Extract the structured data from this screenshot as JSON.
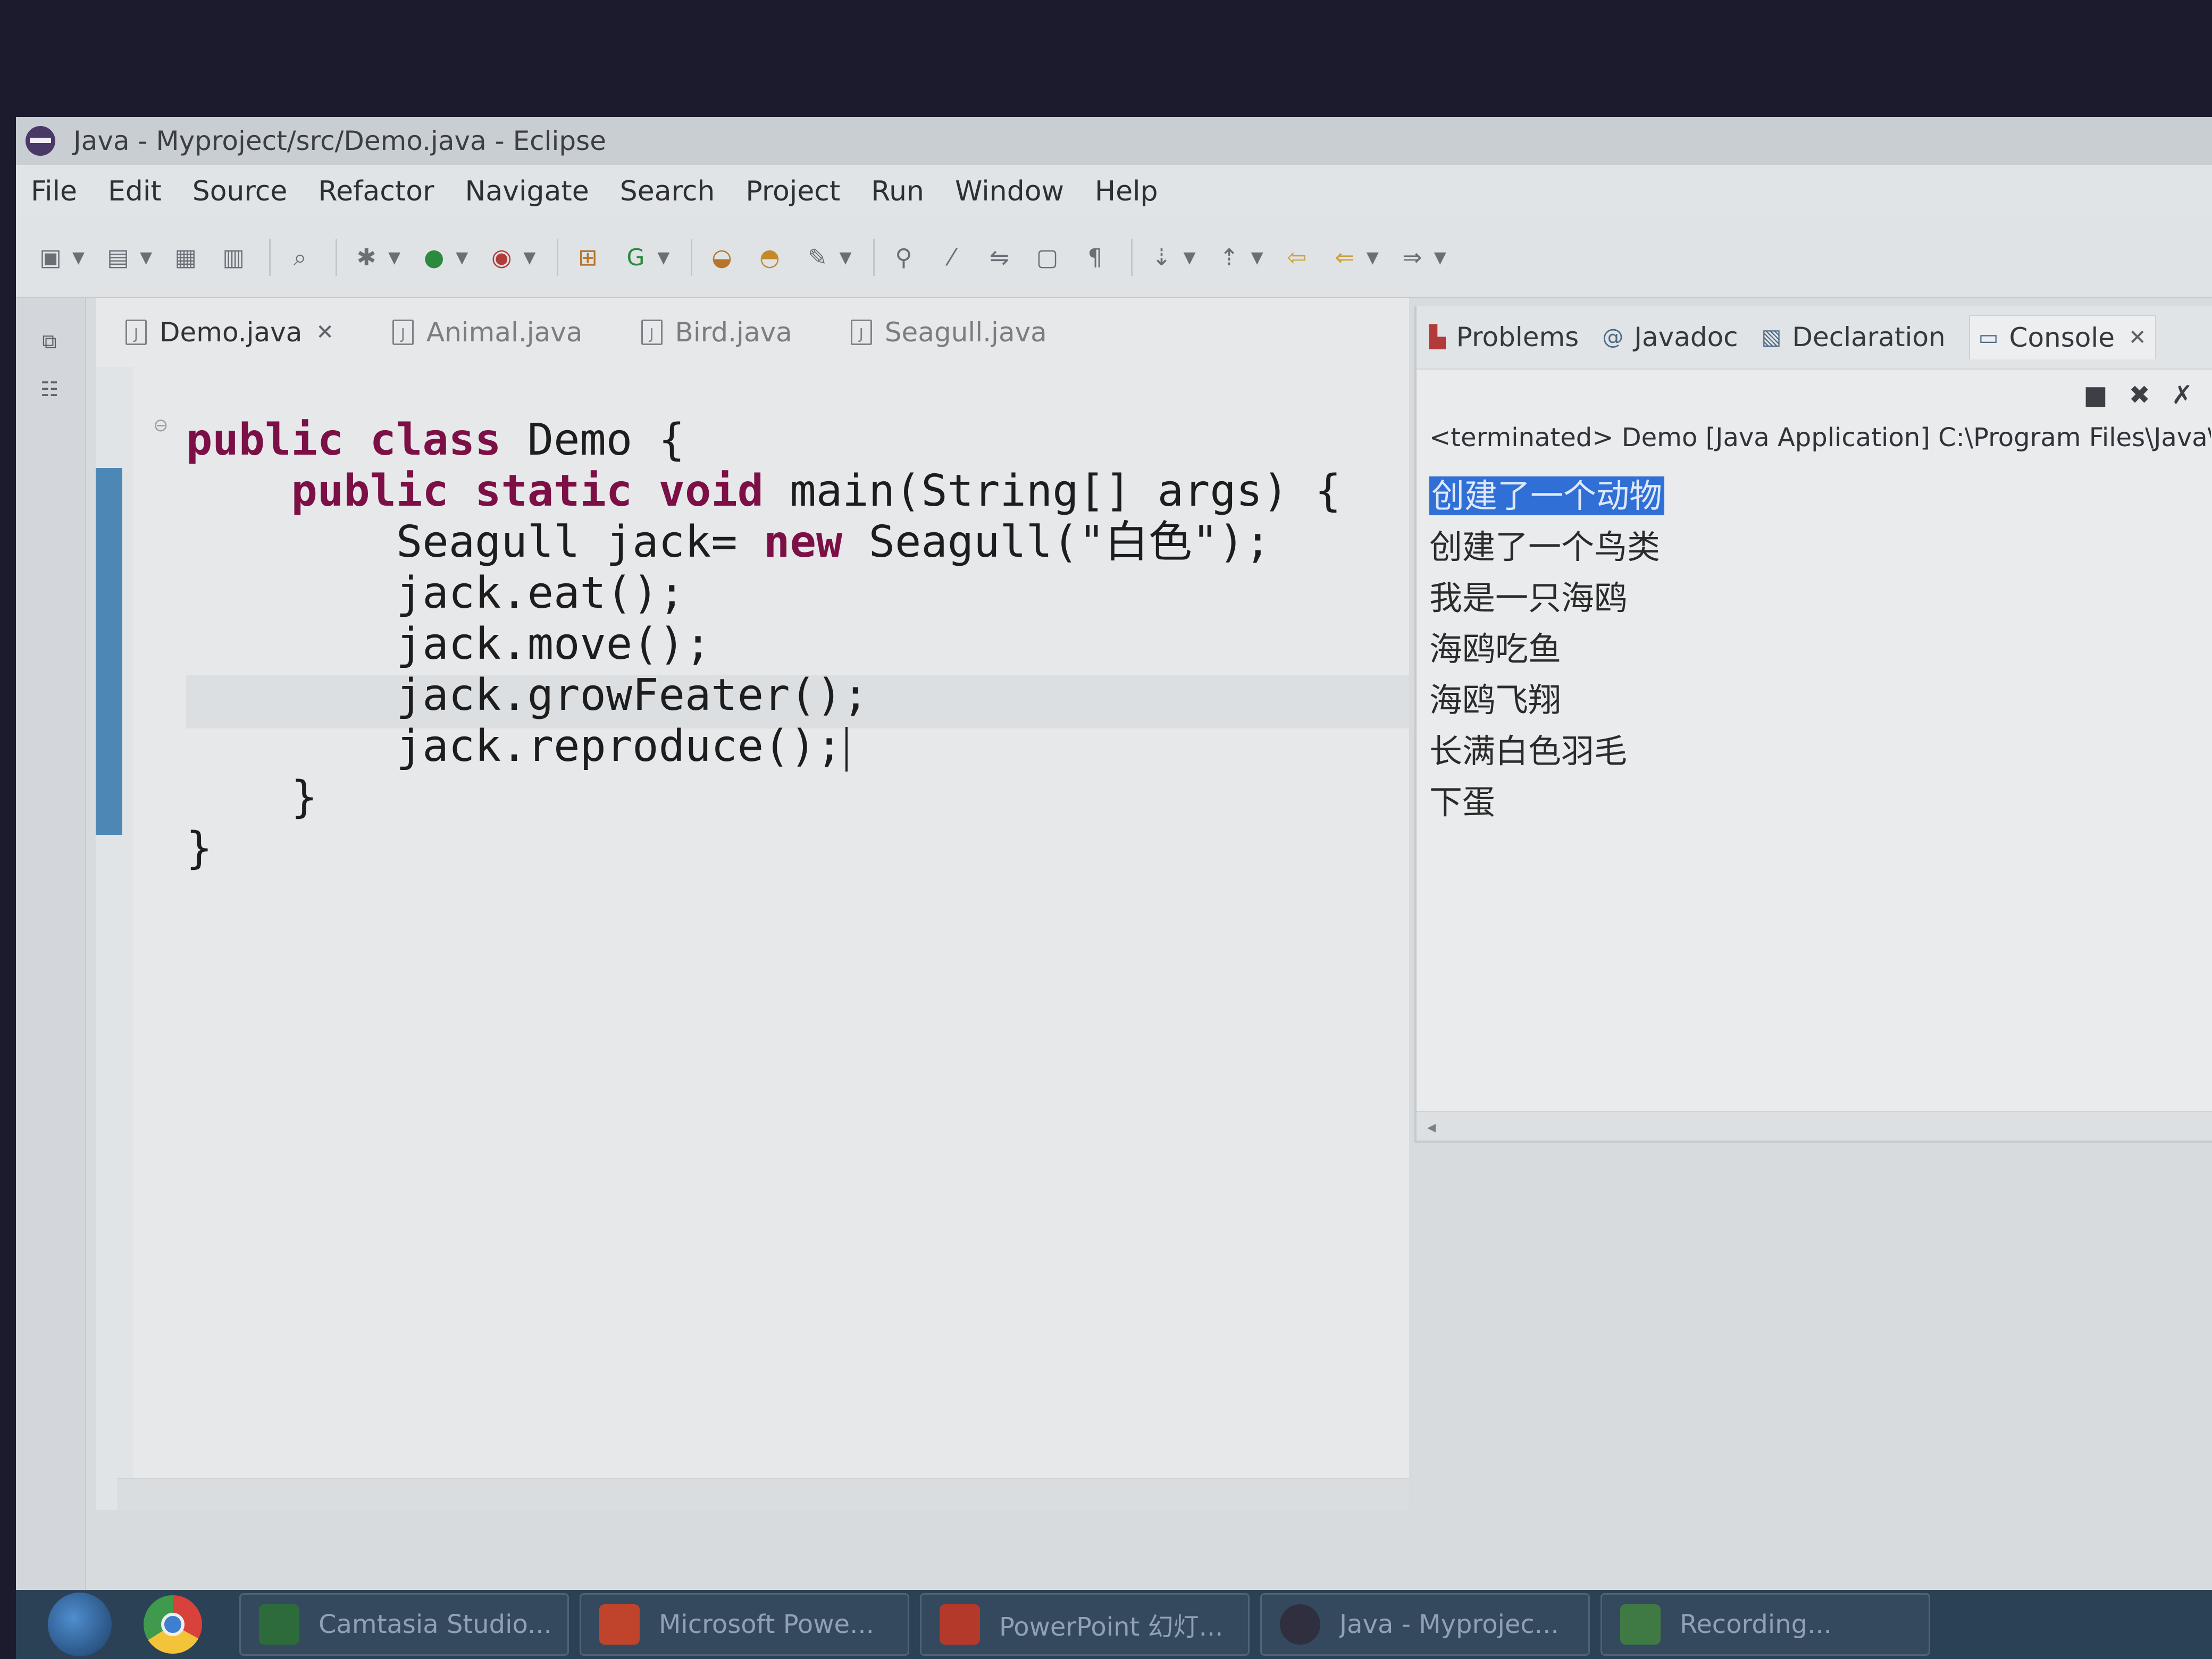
{
  "window": {
    "title": "Java - Myproject/src/Demo.java - Eclipse"
  },
  "menu": [
    "File",
    "Edit",
    "Source",
    "Refactor",
    "Navigate",
    "Search",
    "Project",
    "Run",
    "Window",
    "Help"
  ],
  "editor": {
    "tabs": [
      {
        "label": "Demo.java",
        "active": true
      },
      {
        "label": "Animal.java",
        "active": false
      },
      {
        "label": "Bird.java",
        "active": false
      },
      {
        "label": "Seagull.java",
        "active": false
      }
    ],
    "code": {
      "l1": {
        "kw1": "public",
        "kw2": "class",
        "rest": " Demo {"
      },
      "l2": {
        "kw1": "public",
        "kw2": "static",
        "kw3": "void",
        "rest": " main(String[] args) {"
      },
      "l3": {
        "pre": "Seagull jack= ",
        "kw": "new",
        "rest": " Seagull(\"白色\");"
      },
      "l4": "jack.eat();",
      "l5": "jack.move();",
      "l6": "jack.growFeater();",
      "l7": "jack.reproduce();",
      "l8": "}",
      "l9": "}"
    }
  },
  "panel": {
    "tabs": [
      {
        "label": "Problems",
        "icon": "problems-icon"
      },
      {
        "label": "Javadoc",
        "icon": "at-icon"
      },
      {
        "label": "Declaration",
        "icon": "declaration-icon"
      },
      {
        "label": "Console",
        "icon": "console-icon"
      }
    ],
    "console_status": "<terminated> Demo [Java Application] C:\\Program Files\\Java\\jr",
    "console_lines": [
      "创建了一个动物",
      "创建了一个鸟类",
      "我是一只海鸥",
      "海鸥吃鱼",
      "海鸥飞翔",
      "长满白色羽毛",
      "下蛋"
    ]
  },
  "taskbar": {
    "items": [
      {
        "label": "Camtasia Studio...",
        "color": "#2d6b3a"
      },
      {
        "label": "Microsoft Powe...",
        "color": "#c0432b"
      },
      {
        "label": "PowerPoint 幻灯...",
        "color": "#b4392a"
      },
      {
        "label": "Java - Myprojec...",
        "color": "#2f2f40"
      },
      {
        "label": "Recording...",
        "color": "#3f7a45"
      }
    ]
  },
  "colors": {
    "keyword": "#7b0f46",
    "selection": "#2f6fd6",
    "ruler": "#4d87b6"
  }
}
